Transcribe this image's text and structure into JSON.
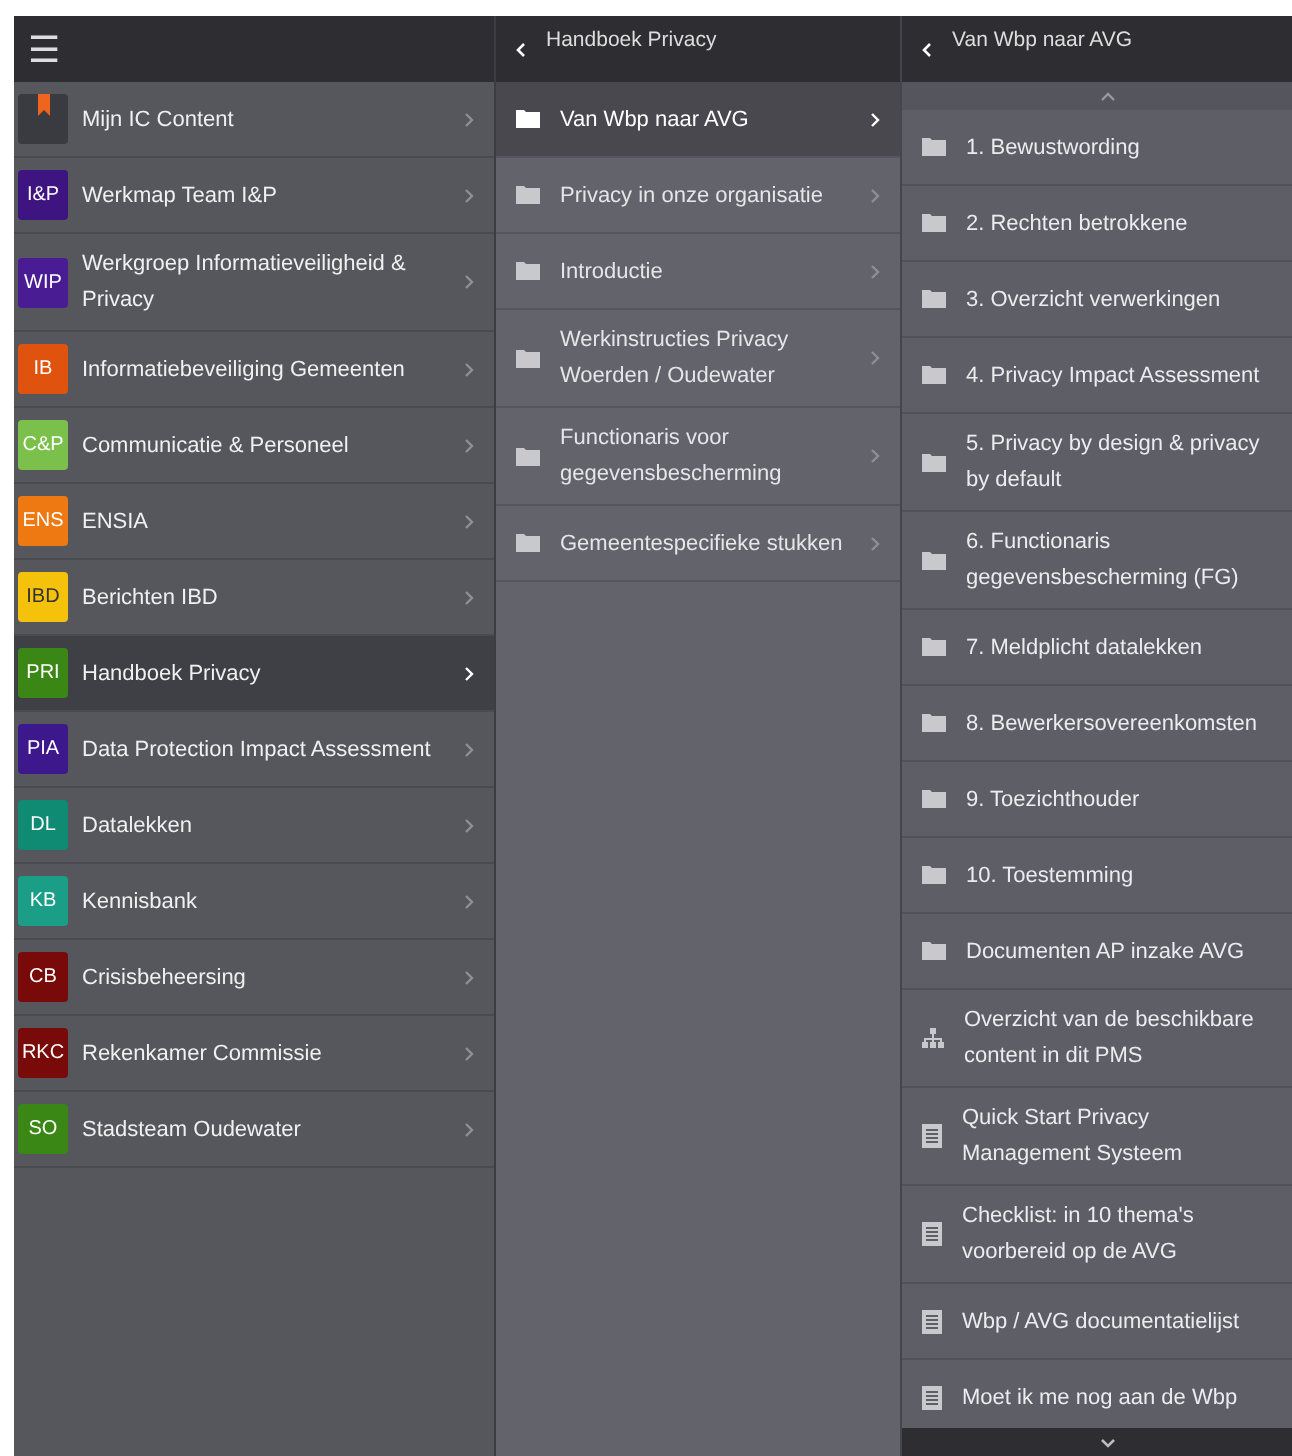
{
  "menu_button": "☰",
  "sections": [
    {
      "kind": "bookmark",
      "color": "#3a3b41",
      "label": "Mijn IC Content",
      "selected": false
    },
    {
      "badge": "I&P",
      "kind": "text",
      "color": "#3d1480",
      "label": "Werkmap Team I&P",
      "selected": false
    },
    {
      "badge": "WIP",
      "kind": "text",
      "color": "#4a1c94",
      "label": "Werkgroep Informatieveiligheid & Privacy",
      "selected": false
    },
    {
      "badge": "IB",
      "kind": "text",
      "color": "#e0530f",
      "label": "Informatiebeveiliging Gemeenten",
      "selected": false
    },
    {
      "badge": "C&P",
      "kind": "text",
      "color": "#7cc04c",
      "label": "Communicatie & Personeel",
      "selected": false
    },
    {
      "badge": "ENS",
      "kind": "text",
      "color": "#ee7812",
      "label": "ENSIA",
      "selected": false
    },
    {
      "badge": "IBD",
      "kind": "text",
      "color": "#f4c20a",
      "label": "Berichten IBD",
      "selected": false
    },
    {
      "badge": "PRI",
      "kind": "text",
      "color": "#3b8716",
      "label": "Handboek Privacy",
      "selected": true
    },
    {
      "badge": "PIA",
      "kind": "text",
      "color": "#3c188c",
      "label": "Data Protection Impact Assessment",
      "selected": false
    },
    {
      "badge": "DL",
      "kind": "text",
      "color": "#0f8a73",
      "label": "Datalekken",
      "selected": false
    },
    {
      "badge": "KB",
      "kind": "text",
      "color": "#1a9e87",
      "label": "Kennisbank",
      "selected": false
    },
    {
      "badge": "CB",
      "kind": "text",
      "color": "#780a0a",
      "label": "Crisisbeheersing",
      "selected": false
    },
    {
      "badge": "RKC",
      "kind": "text",
      "color": "#780a0a",
      "label": "Rekenkamer Commissie",
      "selected": false
    },
    {
      "badge": "SO",
      "kind": "text",
      "color": "#3b8716",
      "label": "Stadsteam Oudewater",
      "selected": false
    }
  ],
  "level2": {
    "title": "Handboek Privacy",
    "items": [
      {
        "label": "Van Wbp naar AVG",
        "selected": true
      },
      {
        "label": "Privacy in onze organisatie",
        "selected": false
      },
      {
        "label": "Introductie",
        "selected": false
      },
      {
        "label": "Werkinstructies Privacy Woerden / Oudewater",
        "selected": false
      },
      {
        "label": "Functionaris voor gegevensbescherming",
        "selected": false
      },
      {
        "label": "Gemeentespecifieke stukken",
        "selected": false
      }
    ]
  },
  "level3": {
    "title": "Van Wbp naar AVG",
    "items": [
      {
        "kind": "folder",
        "label": "1. Bewustwording"
      },
      {
        "kind": "folder",
        "label": "2. Rechten betrokkene"
      },
      {
        "kind": "folder",
        "label": "3. Overzicht verwerkingen"
      },
      {
        "kind": "folder",
        "label": "4. Privacy Impact Assessment"
      },
      {
        "kind": "folder",
        "label": "5. Privacy by design & privacy by default"
      },
      {
        "kind": "folder",
        "label": "6. Functionaris gegevensbescherming (FG)"
      },
      {
        "kind": "folder",
        "label": "7. Meldplicht datalekken"
      },
      {
        "kind": "folder",
        "label": "8. Bewerkersovereenkomsten"
      },
      {
        "kind": "folder",
        "label": "9. Toezichthouder"
      },
      {
        "kind": "folder",
        "label": "10. Toestemming"
      },
      {
        "kind": "folder",
        "label": "Documenten AP inzake AVG"
      },
      {
        "kind": "sitemap",
        "label": "Overzicht van de beschikbare content in dit PMS"
      },
      {
        "kind": "document",
        "label": "Quick Start Privacy Management Systeem"
      },
      {
        "kind": "document",
        "label": "Checklist: in 10 thema's voorbereid op de AVG"
      },
      {
        "kind": "document",
        "label": "Wbp / AVG documentatielijst"
      },
      {
        "kind": "document",
        "label": "Moet ik me nog aan de Wbp"
      }
    ]
  }
}
